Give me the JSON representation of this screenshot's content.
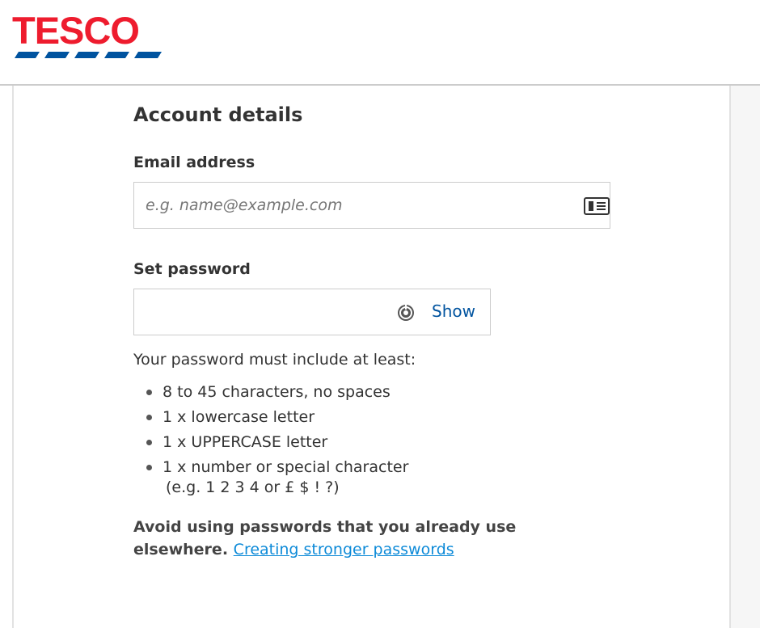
{
  "brand": {
    "logo_text": "TESCO",
    "logo_red": "#ee1c2e",
    "logo_blue": "#00539f"
  },
  "form": {
    "section_title": "Account details",
    "email": {
      "label": "Email address",
      "placeholder": "e.g. name@example.com",
      "value": "",
      "icon": "contact-card-icon"
    },
    "password": {
      "label": "Set password",
      "value": "",
      "manager_icon": "password-manager-icon",
      "show_label": "Show"
    },
    "requirements": {
      "intro": "Your password must include at least:",
      "items": [
        "8 to 45 characters, no spaces",
        "1 x lowercase letter",
        "1 x UPPERCASE letter",
        "1 x number or special character"
      ],
      "item_note": "(e.g. 1 2 3 4 or £ $ ! ?)"
    },
    "advice": {
      "text": "Avoid using passwords that you already use elsewhere.",
      "link_label": "Creating stronger passwords"
    }
  },
  "colors": {
    "text": "#333333",
    "link": "#0d8ad8",
    "show_link": "#00539f",
    "border": "#cccccc"
  }
}
